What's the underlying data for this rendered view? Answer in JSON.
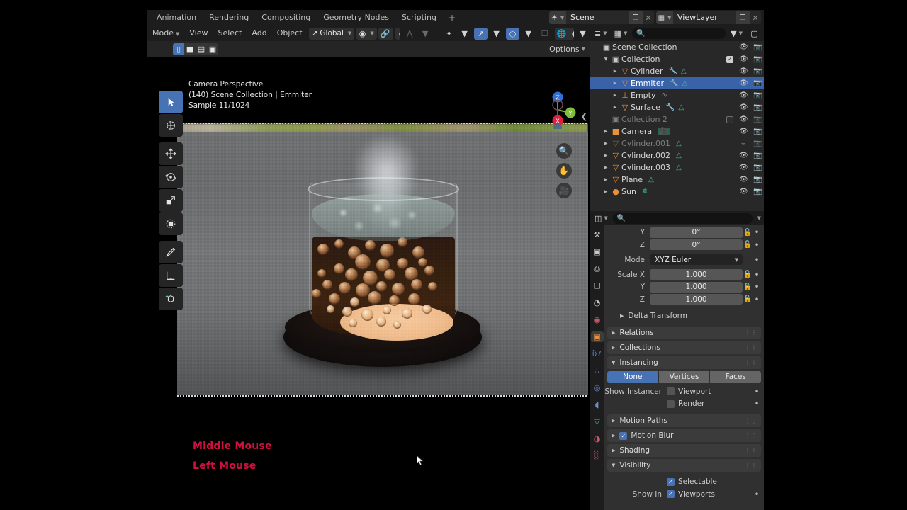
{
  "app": "Blender",
  "topbar": {
    "tabs": [
      "Animation",
      "Rendering",
      "Compositing",
      "Geometry Nodes",
      "Scripting"
    ],
    "add_tab": "+",
    "scene": {
      "icon": "scene-icon",
      "name": "Scene",
      "new_label": "❐",
      "unlink_label": "✕"
    },
    "viewlayer": {
      "icon": "viewlayer-icon",
      "name": "ViewLayer",
      "new_label": "❐",
      "unlink_label": "✕"
    }
  },
  "viewport_header": {
    "mode": "Mode",
    "menus": [
      "View",
      "Select",
      "Add",
      "Object"
    ],
    "transform_orientation": "Global",
    "snap_icon": "magnet-icon",
    "proportional_icon": "proportional-editing-icon",
    "falloff_icon": "falloff-curve-icon",
    "pivot_icon": "pivot-point-icon",
    "snapping_icon": "snap-increment-icon",
    "show_gizmo_icon": "gizmo-icon",
    "overlays_icon": "overlays-icon",
    "xray_icon": "xray-icon",
    "shading": [
      "wireframe-icon",
      "solid-icon",
      "material-preview-icon",
      "rendered-icon"
    ],
    "shading_active": "rendered-icon",
    "options_label": "Options",
    "select_modes": [
      "tweak-select",
      "box-select",
      "circle-select",
      "lasso-select"
    ],
    "select_mode_active": "tweak-select"
  },
  "viewport_overlay": {
    "line1": "Camera Perspective",
    "line2": "(140) Scene Collection | Emmiter",
    "line3": "Sample 11/1024",
    "middle_mouse": "Middle Mouse",
    "left_mouse": "Left Mouse",
    "mouse_text_color": "#d2103f"
  },
  "toolbar": {
    "tools": [
      {
        "name": "tweak-tool",
        "glyph": "▶",
        "active": true
      },
      {
        "name": "cursor-tool",
        "glyph": "⊕",
        "active": false
      },
      {
        "name": "move-tool",
        "glyph": "✥",
        "active": false
      },
      {
        "name": "rotate-tool",
        "glyph": "↻",
        "active": false
      },
      {
        "name": "scale-tool",
        "glyph": "◰",
        "active": false
      },
      {
        "name": "transform-tool",
        "glyph": "⬚",
        "active": false
      },
      {
        "name": "annotate-tool",
        "glyph": "✎",
        "active": false
      },
      {
        "name": "measure-tool",
        "glyph": "⏏",
        "active": false
      },
      {
        "name": "add-cube-tool",
        "glyph": "⬛",
        "active": false
      }
    ]
  },
  "gizmo": {
    "axes": [
      "Z",
      "Y",
      "X"
    ],
    "zoom_icon": "zoom-icon",
    "pan_icon": "hand-icon",
    "camera_icon": "camera-view-icon"
  },
  "outliner": {
    "display_mode_icon": "display-mode-icon",
    "filter_icon": "filter-icon",
    "new_collection_icon": "new-collection-icon",
    "search_placeholder": "",
    "rows": [
      {
        "indent": 0,
        "tri": "",
        "icon": "▣",
        "icon_color": "#c8c8c8",
        "label": "Scene Collection",
        "mods": [],
        "checkbox": null,
        "eye": false,
        "camera": false,
        "selected": false,
        "disabled": false
      },
      {
        "indent": 1,
        "tri": "▼",
        "icon": "▣",
        "icon_color": "#c8c8c8",
        "label": "Collection",
        "mods": [],
        "checkbox": true,
        "eye": true,
        "camera": true,
        "selected": false,
        "disabled": false
      },
      {
        "indent": 2,
        "tri": "▶",
        "icon": "▽",
        "icon_color": "#e8913c",
        "label": "Cylinder",
        "mods": [
          "wrench",
          "mesh"
        ],
        "checkbox": null,
        "eye": true,
        "camera": true,
        "selected": false,
        "disabled": false
      },
      {
        "indent": 2,
        "tri": "▶",
        "icon": "▽",
        "icon_color": "#e8913c",
        "label": "Emmiter",
        "mods": [
          "wrench",
          "mesh"
        ],
        "checkbox": null,
        "eye": true,
        "camera": true,
        "selected": true,
        "disabled": false
      },
      {
        "indent": 2,
        "tri": "▶",
        "icon": "⊥",
        "icon_color": "#e8913c",
        "label": "Empty",
        "mods": [
          "anim"
        ],
        "checkbox": null,
        "eye": true,
        "camera": true,
        "selected": false,
        "disabled": false
      },
      {
        "indent": 2,
        "tri": "▶",
        "icon": "▽",
        "icon_color": "#e8913c",
        "label": "Surface",
        "mods": [
          "wrench",
          "mesh"
        ],
        "checkbox": null,
        "eye": true,
        "camera": true,
        "selected": false,
        "disabled": false
      },
      {
        "indent": 1,
        "tri": "",
        "icon": "▣",
        "icon_color": "#808080",
        "label": "Collection 2",
        "mods": [],
        "checkbox": false,
        "eye": true,
        "camera": true,
        "selected": false,
        "disabled": true
      },
      {
        "indent": 1,
        "tri": "▶",
        "icon": "■",
        "icon_color": "#e8913c",
        "label": "Camera",
        "mods": [
          "cameradata"
        ],
        "checkbox": null,
        "eye": true,
        "camera": true,
        "selected": false,
        "disabled": false
      },
      {
        "indent": 1,
        "tri": "▶",
        "icon": "▽",
        "icon_color": "#8a6236",
        "label": "Cylinder.001",
        "mods": [
          "mesh"
        ],
        "checkbox": null,
        "eye": "closed",
        "camera": true,
        "selected": false,
        "disabled": true
      },
      {
        "indent": 1,
        "tri": "▶",
        "icon": "▽",
        "icon_color": "#e8913c",
        "label": "Cylinder.002",
        "mods": [
          "mesh"
        ],
        "checkbox": null,
        "eye": true,
        "camera": true,
        "selected": false,
        "disabled": false
      },
      {
        "indent": 1,
        "tri": "▶",
        "icon": "▽",
        "icon_color": "#e8913c",
        "label": "Cylinder.003",
        "mods": [
          "mesh"
        ],
        "checkbox": null,
        "eye": true,
        "camera": true,
        "selected": false,
        "disabled": false
      },
      {
        "indent": 1,
        "tri": "▶",
        "icon": "▽",
        "icon_color": "#e8913c",
        "label": "Plane",
        "mods": [
          "mesh"
        ],
        "checkbox": null,
        "eye": true,
        "camera": true,
        "selected": false,
        "disabled": false
      },
      {
        "indent": 1,
        "tri": "▶",
        "icon": "●",
        "icon_color": "#e8913c",
        "label": "Sun",
        "mods": [
          "light"
        ],
        "checkbox": null,
        "eye": true,
        "camera": true,
        "selected": false,
        "disabled": false
      }
    ]
  },
  "properties": {
    "editor_icon": "properties-editor-icon",
    "search_placeholder": "",
    "tabs": [
      {
        "name": "tool-tab",
        "glyph": "⚒",
        "color": "#c9c9c9",
        "active": false
      },
      {
        "name": "render-tab",
        "glyph": "▣",
        "color": "#c9c9c9",
        "active": false
      },
      {
        "name": "output-tab",
        "glyph": "⎙",
        "color": "#c9c9c9",
        "active": false
      },
      {
        "name": "view-layer-tab",
        "glyph": "❑",
        "color": "#c9c9c9",
        "active": false
      },
      {
        "name": "scene-tab",
        "glyph": "◔",
        "color": "#c9c9c9",
        "active": false
      },
      {
        "name": "world-tab",
        "glyph": "◉",
        "color": "#c4576b",
        "active": false
      },
      {
        "name": "object-tab",
        "glyph": "▣",
        "color": "#e8913c",
        "active": true
      },
      {
        "name": "modifier-tab",
        "glyph": "ὒ7",
        "color": "#4f7fd4",
        "active": false
      },
      {
        "name": "particles-tab",
        "glyph": "∴",
        "color": "#6f8cd0",
        "active": false
      },
      {
        "name": "physics-tab",
        "glyph": "◎",
        "color": "#5f7ecf",
        "active": false
      },
      {
        "name": "constraints-tab",
        "glyph": "◖",
        "color": "#6f8cd0",
        "active": false
      },
      {
        "name": "data-tab",
        "glyph": "▽",
        "color": "#3fbf8f",
        "active": false
      },
      {
        "name": "material-tab",
        "glyph": "◑",
        "color": "#c4576b",
        "active": false
      },
      {
        "name": "texture-tab",
        "glyph": "░",
        "color": "#c4576b",
        "active": false
      }
    ],
    "transform": {
      "rows": [
        {
          "label": "Y",
          "value": "0°",
          "type": "num"
        },
        {
          "label": "Z",
          "value": "0°",
          "type": "num"
        },
        {
          "label": "Mode",
          "value": "XYZ Euler",
          "type": "dropdown"
        },
        {
          "label": "Scale X",
          "value": "1.000",
          "type": "num"
        },
        {
          "label": "Y",
          "value": "1.000",
          "type": "num"
        },
        {
          "label": "Z",
          "value": "1.000",
          "type": "num"
        }
      ],
      "delta_transform": "Delta Transform"
    },
    "panels": [
      {
        "label": "Relations",
        "open": false,
        "checkbox": null
      },
      {
        "label": "Collections",
        "open": false,
        "checkbox": null
      },
      {
        "label": "Instancing",
        "open": true,
        "checkbox": null
      }
    ],
    "instancing": {
      "options": [
        "None",
        "Vertices",
        "Faces"
      ],
      "selected": "None",
      "show_instancer_label": "Show Instancer",
      "viewport_label": "Viewport",
      "viewport_checked": false,
      "render_label": "Render",
      "render_checked": false
    },
    "lower_panels": [
      {
        "label": "Motion Paths",
        "open": false,
        "checkbox": null
      },
      {
        "label": "Motion Blur",
        "open": false,
        "checkbox": true
      },
      {
        "label": "Shading",
        "open": false,
        "checkbox": null
      },
      {
        "label": "Visibility",
        "open": true,
        "checkbox": null
      }
    ],
    "visibility": {
      "selectable_label": "Selectable",
      "selectable_checked": true,
      "show_in_label": "Show In",
      "viewports_label": "Viewports",
      "viewports_checked": true
    }
  },
  "colors": {
    "accent_blue": "#4772b3",
    "select_row": "#3a62a8",
    "orange_object": "#e8913c",
    "mesh_green": "#3fbf8f",
    "mouse_red": "#d2103f",
    "bg_editor": "#303030",
    "bg_outliner": "#282828",
    "bg_header": "#1d1d1d"
  }
}
